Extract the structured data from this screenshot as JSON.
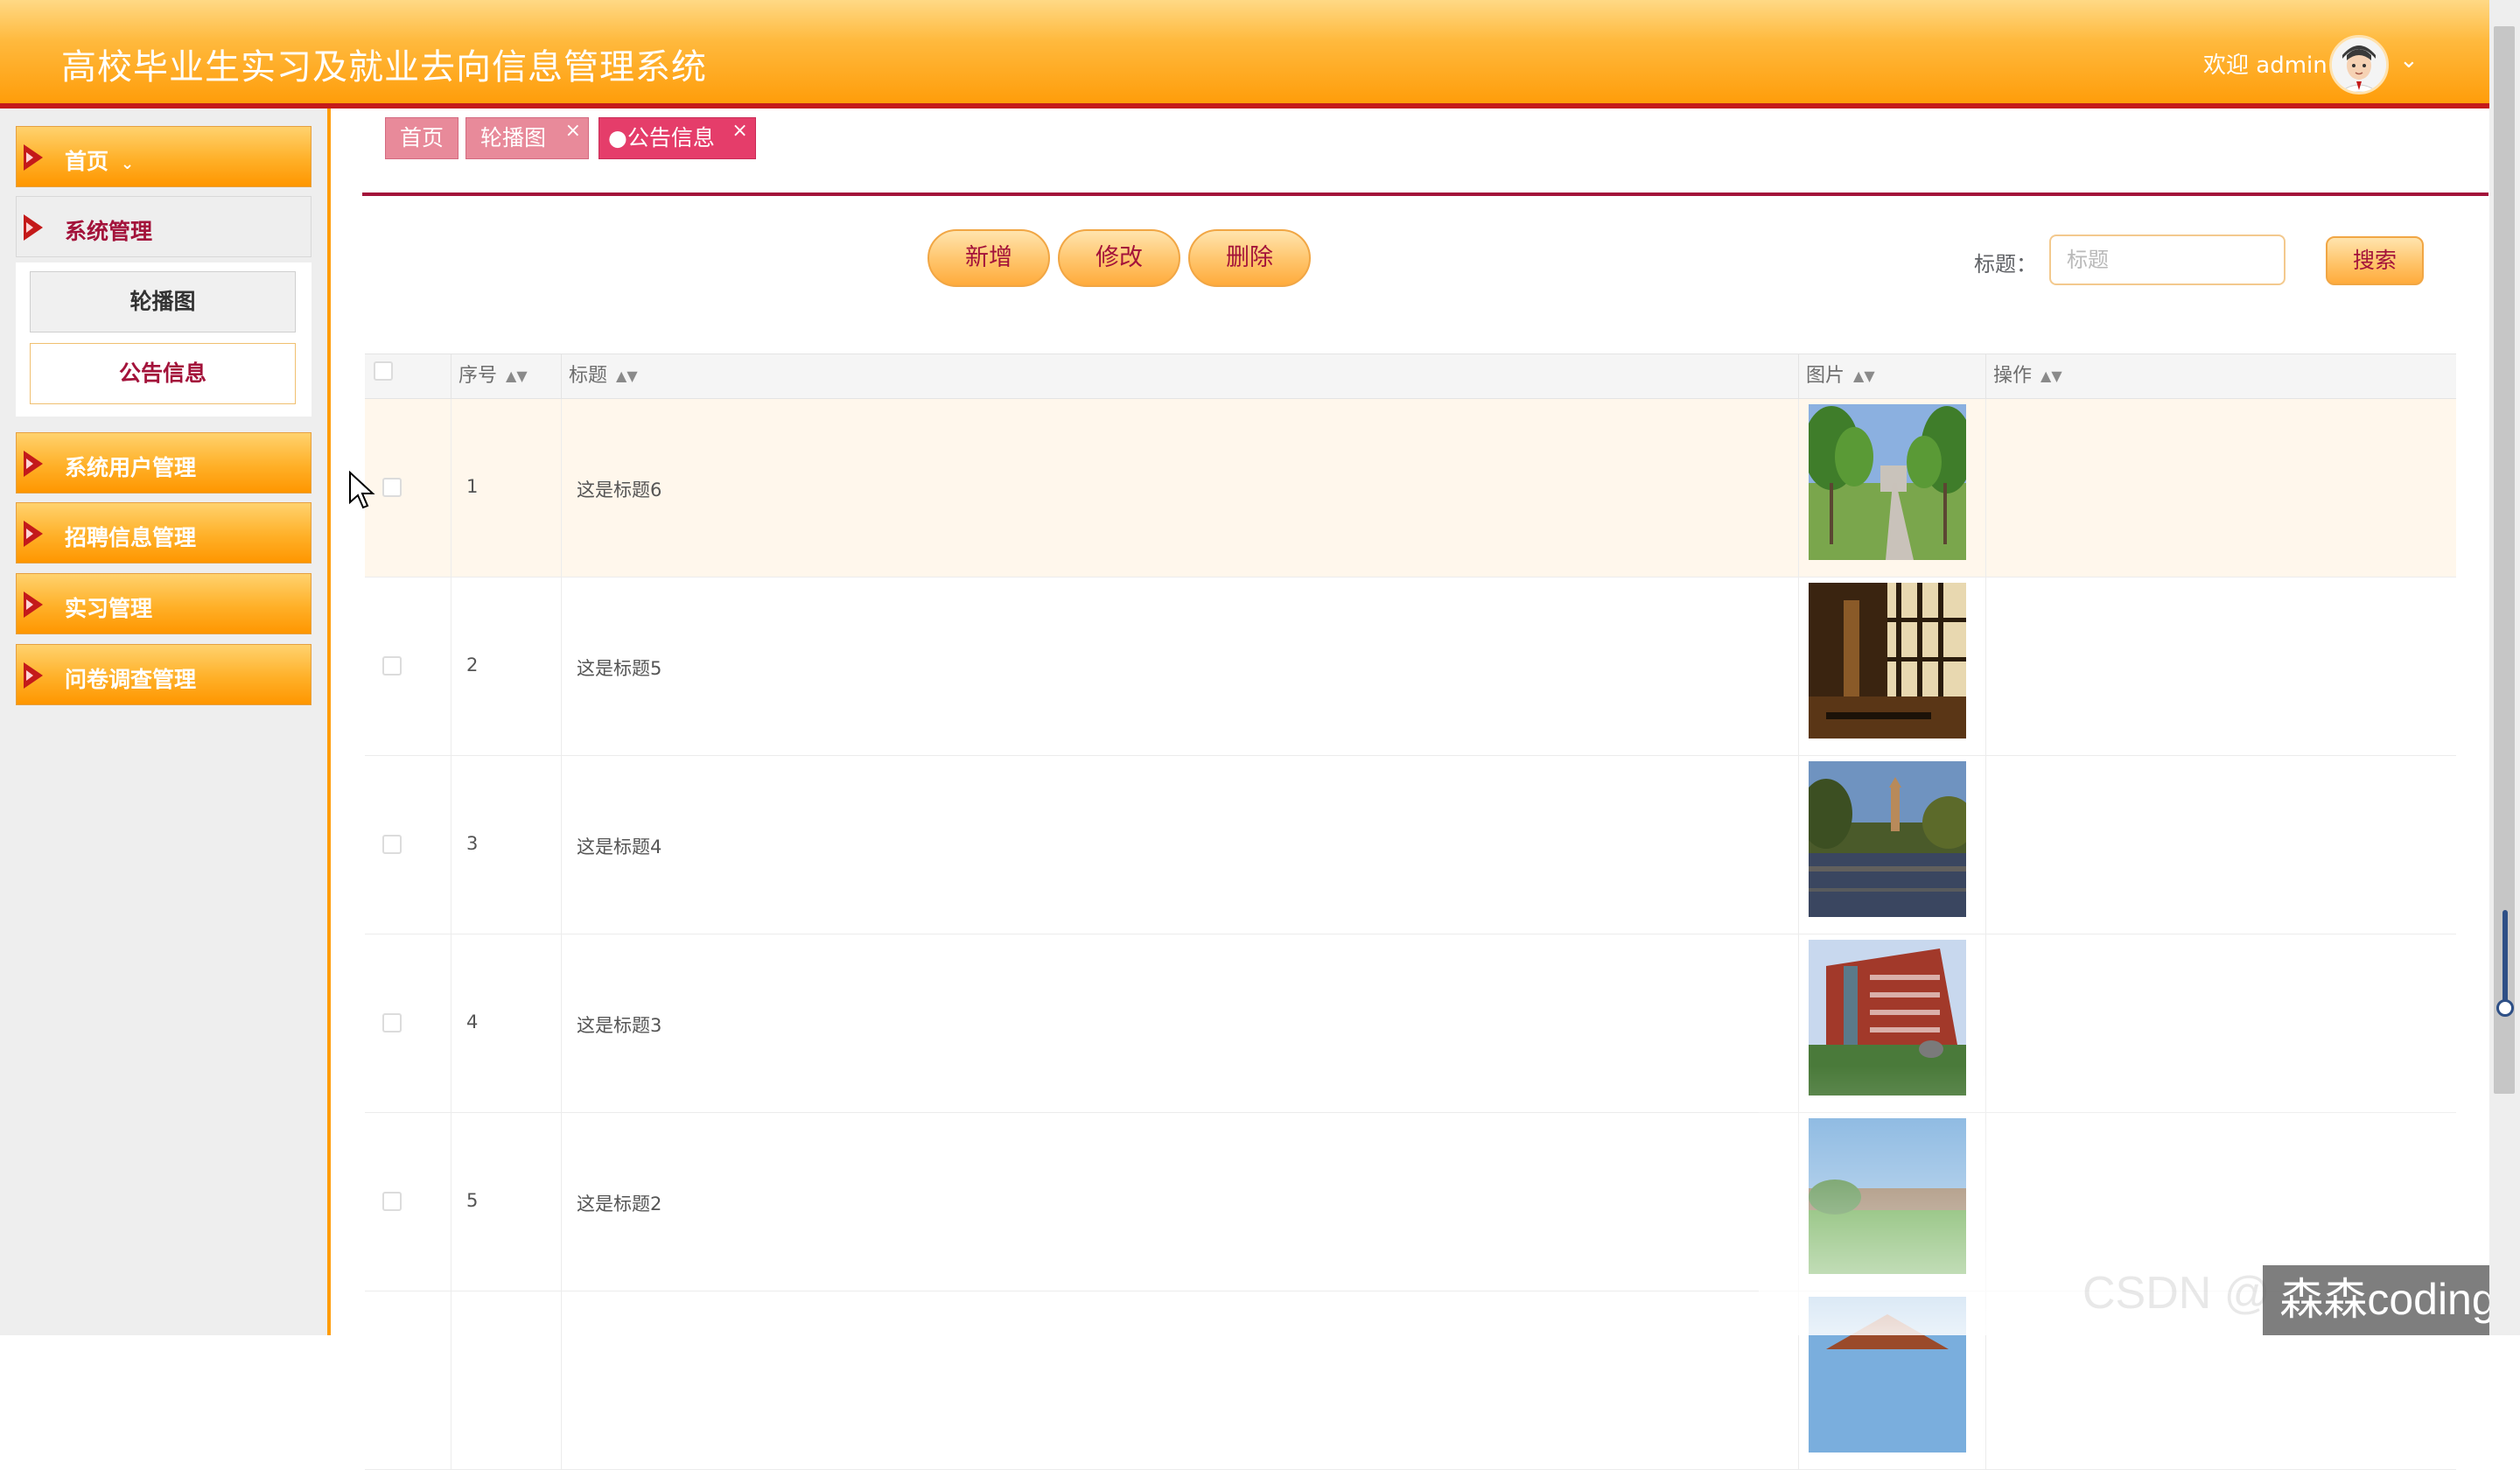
{
  "app": {
    "title": "高校毕业生实习及就业去向信息管理系统",
    "welcome": "欢迎 admin"
  },
  "sidebar": {
    "items": [
      {
        "label": "首页"
      },
      {
        "label": "系统管理"
      },
      {
        "label": "系统用户管理"
      },
      {
        "label": "招聘信息管理"
      },
      {
        "label": "实习管理"
      },
      {
        "label": "问卷调查管理"
      }
    ],
    "submenu": [
      {
        "label": "轮播图"
      },
      {
        "label": "公告信息"
      }
    ]
  },
  "tabs": [
    {
      "label": "首页"
    },
    {
      "label": "轮播图"
    },
    {
      "label": "●公告信息"
    }
  ],
  "toolbar": {
    "add_label": "新增",
    "edit_label": "修改",
    "delete_label": "删除"
  },
  "search": {
    "label": "标题：",
    "placeholder": "标题",
    "button_label": "搜索"
  },
  "table": {
    "columns": [
      "序号",
      "标题",
      "图片",
      "操作"
    ],
    "rows": [
      {
        "num": "1",
        "title": "这是标题6"
      },
      {
        "num": "2",
        "title": "这是标题5"
      },
      {
        "num": "3",
        "title": "这是标题4"
      },
      {
        "num": "4",
        "title": "这是标题3"
      },
      {
        "num": "5",
        "title": "这是标题2"
      }
    ]
  },
  "watermark": {
    "text": "森森coding",
    "faint_text": "CSDN @"
  },
  "colors": {
    "accent": "#ff9d0a",
    "brand_red": "#a3123a",
    "tab_pink": "#e88a9a",
    "tab_active": "#e53d6a"
  }
}
